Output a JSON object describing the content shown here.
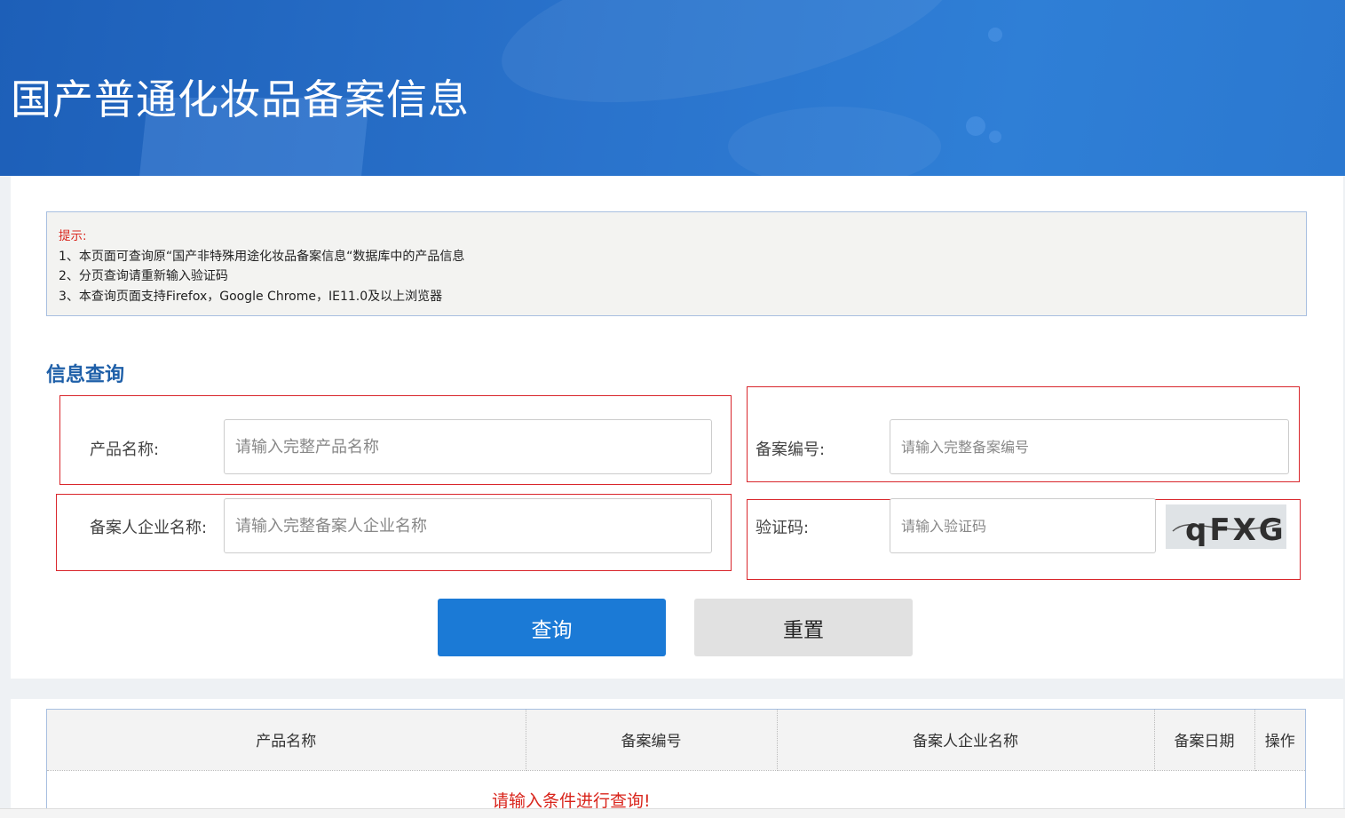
{
  "header": {
    "title": "国产普通化妆品备案信息"
  },
  "notice": {
    "title": "提示:",
    "lines": [
      "1、本页面可查询原“国产非特殊用途化妆品备案信息“数据库中的产品信息",
      "2、分页查询请重新输入验证码",
      "3、本查询页面支持Firefox，Google Chrome，IE11.0及以上浏览器"
    ]
  },
  "search": {
    "section_title": "信息查询",
    "product_name": {
      "label": "产品名称:",
      "placeholder": "请输入完整产品名称"
    },
    "record_no": {
      "label": "备案编号:",
      "placeholder": "请输入完整备案编号"
    },
    "company": {
      "label": "备案人企业名称:",
      "placeholder": "请输入完整备案人企业名称"
    },
    "captcha": {
      "label": "验证码:",
      "placeholder": "请输入验证码",
      "image_text": "qFXG"
    },
    "query_label": "查询",
    "reset_label": "重置"
  },
  "table": {
    "columns": [
      "产品名称",
      "备案编号",
      "备案人企业名称",
      "备案日期",
      "操作"
    ],
    "empty_message": "请输入条件进行查询!"
  },
  "colors": {
    "primary": "#1b7ad6",
    "alert": "#d9251c",
    "heading": "#1e5fa8"
  }
}
